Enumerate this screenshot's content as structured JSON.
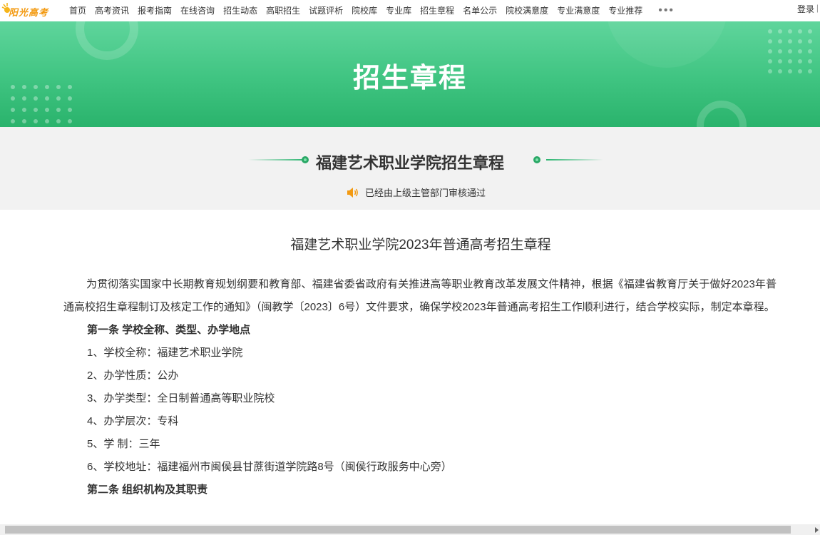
{
  "logo": {
    "text": "阳光高考"
  },
  "nav": {
    "items": [
      "首页",
      "高考资讯",
      "报考指南",
      "在线咨询",
      "招生动态",
      "高职招生",
      "试题评析",
      "院校库",
      "专业库",
      "招生章程",
      "名单公示",
      "院校满意度",
      "专业满意度",
      "专业推荐"
    ],
    "more": "•••",
    "login": "登录",
    "separator": "|"
  },
  "banner": {
    "title": "招生章程"
  },
  "header": {
    "school_title": "福建艺术职业学院招生章程",
    "verified_text": "已经由上级主管部门审核通过"
  },
  "document": {
    "title": "福建艺术职业学院2023年普通高考招生章程",
    "intro": "为贯彻落实国家中长期教育规划纲要和教育部、福建省委省政府有关推进高等职业教育改革发展文件精神，根据《福建省教育厅关于做好2023年普通高校招生章程制订及核定工作的通知》（闽教学〔2023〕6号）文件要求，确保学校2023年普通高考招生工作顺利进行，结合学校实际，制定本章程。",
    "article1": "第一条  学校全称、类型、办学地点",
    "items": [
      "1、学校全称：福建艺术职业学院",
      "2、办学性质：公办",
      "3、办学类型：全日制普通高等职业院校",
      "4、办学层次：专科",
      "5、学    制：三年",
      "6、学校地址：福建福州市闽侯县甘蔗街道学院路8号（闽侯行政服务中心旁）"
    ],
    "article2": "第二条  组织机构及其职责"
  },
  "colors": {
    "accent": "#2ab36c",
    "banner_light": "#5fd59c",
    "subheader_bg": "#f2f2f2"
  }
}
